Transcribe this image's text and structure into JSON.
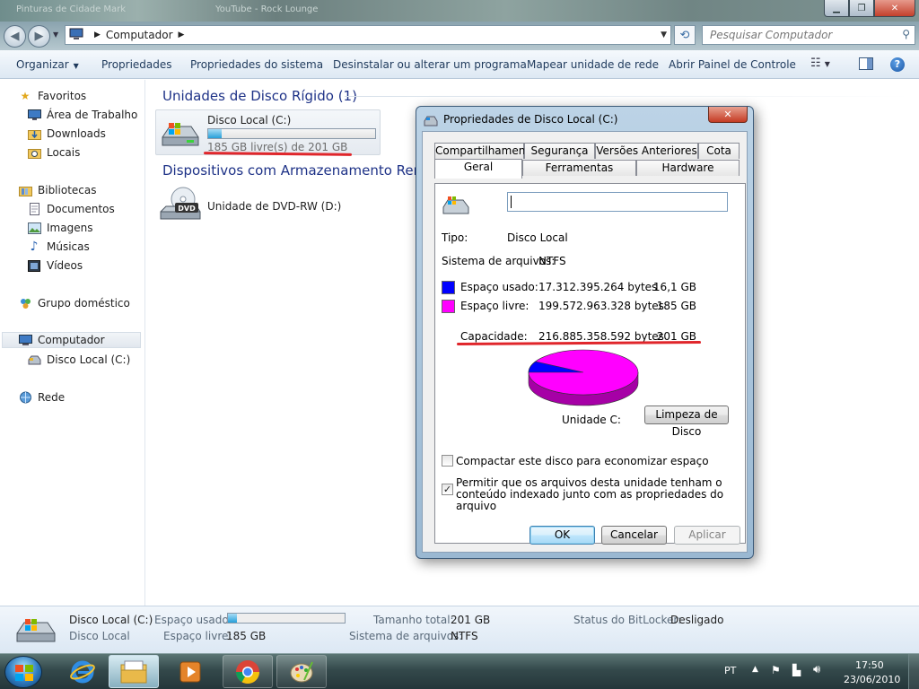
{
  "window": {
    "ghost_title": "Pinturas de Cidade Mark",
    "ghost_tab": "YouTube - Rock Lounge"
  },
  "address": {
    "location": "Computador",
    "search_placeholder": "Pesquisar Computador"
  },
  "toolbar": {
    "organize": "Organizar",
    "properties": "Propriedades",
    "system_properties": "Propriedades do sistema",
    "uninstall": "Desinstalar ou alterar um programa",
    "map_drive": "Mapear unidade de rede",
    "control_panel": "Abrir Painel de Controle"
  },
  "nav": {
    "favorites": "Favoritos",
    "desktop": "Área de Trabalho",
    "downloads": "Downloads",
    "places": "Locais",
    "libraries": "Bibliotecas",
    "documents": "Documentos",
    "pictures": "Imagens",
    "music": "Músicas",
    "videos": "Vídeos",
    "homegroup": "Grupo doméstico",
    "computer": "Computador",
    "local_disk": "Disco Local (C:)",
    "network": "Rede"
  },
  "content": {
    "hdd_group": "Unidades de Disco Rígido (1)",
    "removable_group": "Dispositivos com Armazenamento Removível (1)",
    "drive_c_name": "Disco Local (C:)",
    "drive_c_space": "185 GB livre(s) de 201 GB",
    "drive_c_used_fraction": 0.08,
    "dvd_name": "Unidade de DVD-RW (D:)",
    "dvd_badge": "DVD"
  },
  "dialog": {
    "title": "Propriedades de Disco Local (C:)",
    "tabs_row1": [
      "Compartilhamento",
      "Segurança",
      "Versões Anteriores",
      "Cota"
    ],
    "tabs_row2": [
      "Geral",
      "Ferramentas",
      "Hardware"
    ],
    "name_value": "",
    "type_label": "Tipo:",
    "type_value": "Disco Local",
    "fs_label": "Sistema de arquivos:",
    "fs_value": "NTFS",
    "used_label": "Espaço usado:",
    "used_bytes": "17.312.395.264 bytes",
    "used_gb": "16,1 GB",
    "free_label": "Espaço livre:",
    "free_bytes": "199.572.963.328 bytes",
    "free_gb": "185 GB",
    "cap_label": "Capacidade:",
    "cap_bytes": "216.885.358.592 bytes",
    "cap_gb": "201 GB",
    "used_color": "#0000ff",
    "free_color": "#ff00ff",
    "used_fraction": 0.0798,
    "drive_label": "Unidade C:",
    "cleanup": "Limpeza de Disco",
    "compress": "Compactar este disco para economizar espaço",
    "compress_checked": false,
    "index": "Permitir que os arquivos desta unidade tenham o conteúdo indexado junto com as propriedades do arquivo",
    "index_checked": true,
    "ok": "OK",
    "cancel": "Cancelar",
    "apply": "Aplicar"
  },
  "details": {
    "name": "Disco Local (C:)",
    "type": "Disco Local",
    "used_label": "Espaço usado:",
    "free_label": "Espaço livre:",
    "free_value": "185 GB",
    "total_label": "Tamanho total:",
    "total_value": "201 GB",
    "fs_label": "Sistema de arquivos:",
    "fs_value": "NTFS",
    "bitlocker_label": "Status do BitLocker:",
    "bitlocker_value": "Desligado",
    "used_fraction": 0.08
  },
  "taskbar": {
    "language": "PT",
    "time": "17:50",
    "date": "23/06/2010"
  }
}
